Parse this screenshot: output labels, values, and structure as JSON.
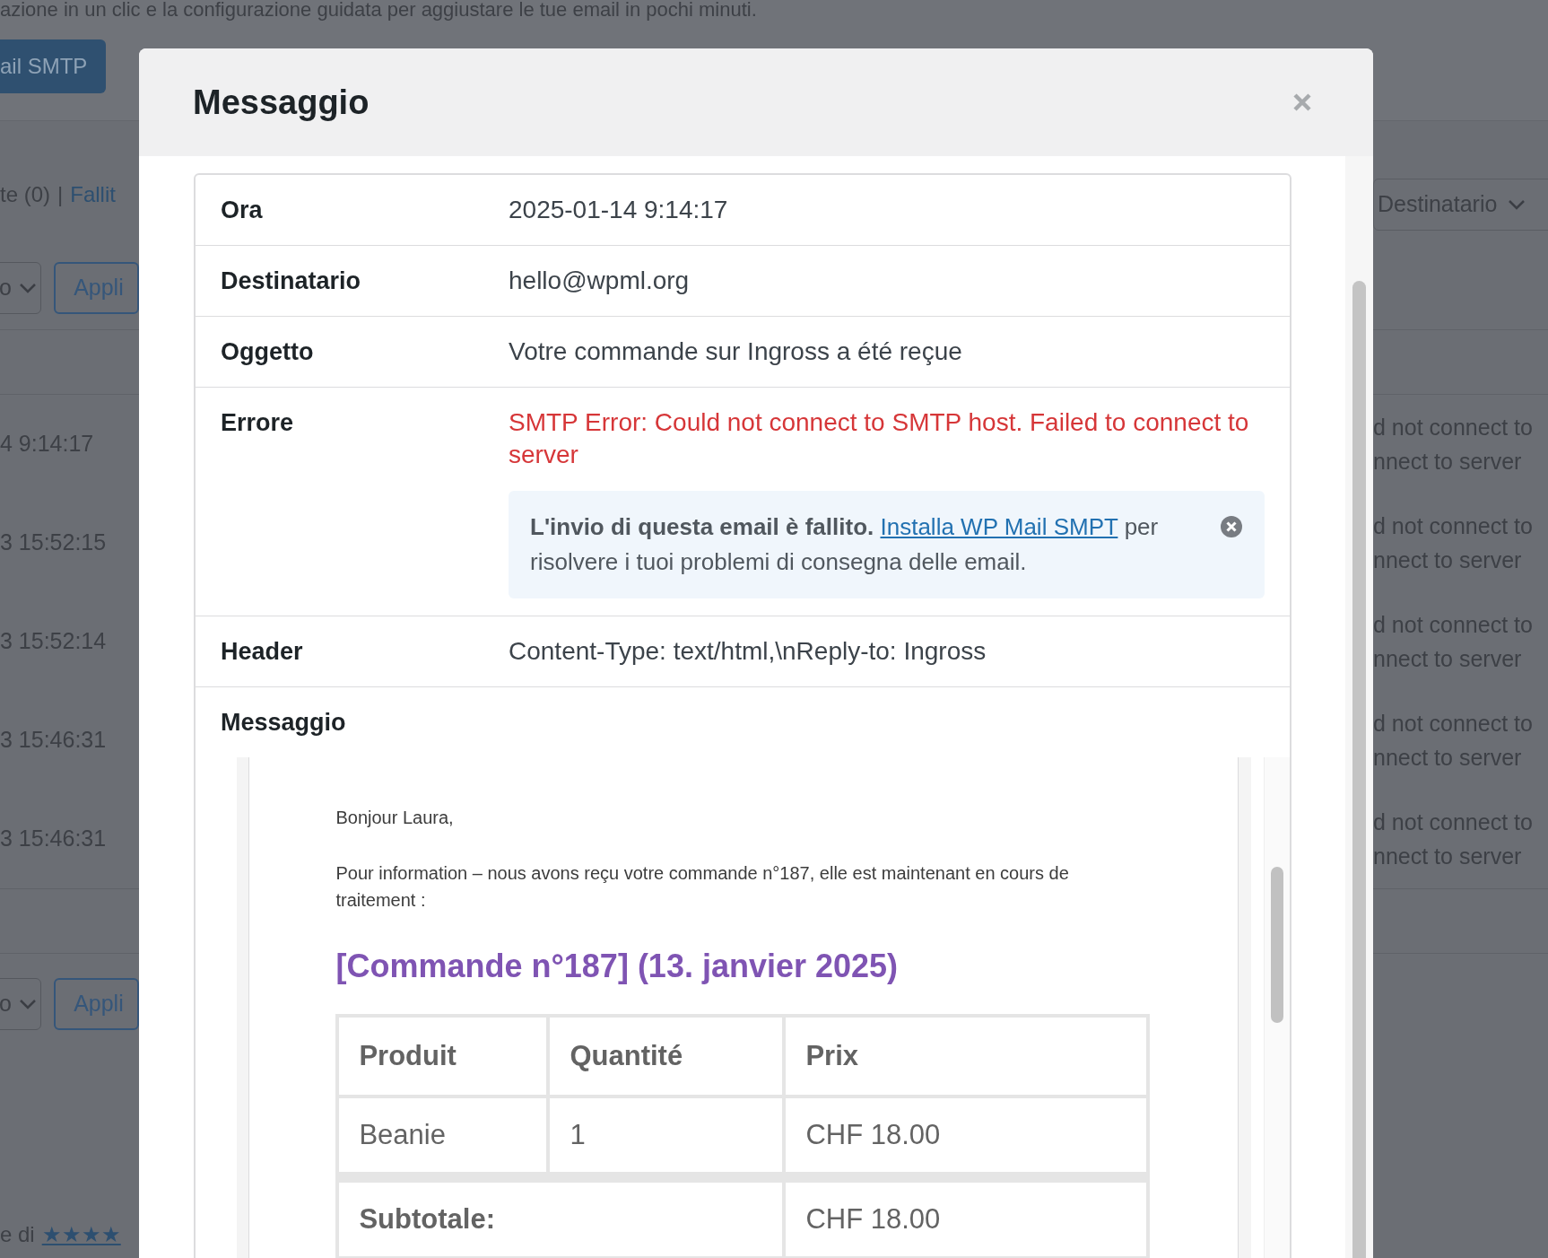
{
  "background": {
    "intro_text": "azione in un clic e la configurazione guidata per aggiustare le tue email in pochi minuti.",
    "smtp_button": "ail SMTP",
    "filter_count": "te (0)",
    "filter_separator": "|",
    "filter_link": "Fallit",
    "bulk_selects": [
      "o",
      "o"
    ],
    "apply_buttons": [
      "Appli",
      "Appli"
    ],
    "recipient_filter": "Destinatario",
    "rows": [
      {
        "time": "4 9:14:17",
        "error_line1": "d not connect to",
        "error_line2": "nnect to server"
      },
      {
        "time": "3 15:52:15",
        "error_line1": "d not connect to",
        "error_line2": "nnect to server"
      },
      {
        "time": "3 15:52:14",
        "error_line1": "d not connect to",
        "error_line2": "nnect to server"
      },
      {
        "time": "3 15:46:31",
        "error_line1": "d not connect to",
        "error_line2": "nnect to server"
      },
      {
        "time": "3 15:46:31",
        "error_line1": "d not connect to",
        "error_line2": "nnect to server"
      }
    ],
    "footer_text": "e di",
    "footer_link": "★★★★"
  },
  "modal": {
    "title": "Messaggio",
    "fields": [
      {
        "kind": "text",
        "label": "Ora",
        "value": "2025-01-14 9:14:17"
      },
      {
        "kind": "text",
        "label": "Destinatario",
        "value": "hello@wpml.org"
      },
      {
        "kind": "text",
        "label": "Oggetto",
        "value": "Votre commande sur Ingross a été reçue"
      },
      {
        "kind": "error",
        "label": "Errore",
        "value": "SMTP Error: Could not connect to SMTP host. Failed to connect to server",
        "notice": {
          "lead": "**L'invio di questa email è fallito.**",
          "link": "Installa WP Mail SMPT",
          "rest": "per risolvere i tuoi problemi di consegna delle email."
        }
      },
      {
        "kind": "text",
        "label": "Header",
        "value": "Content-Type: text/html,\\nReply-to: Ingross"
      },
      {
        "kind": "message",
        "label": "Messaggio"
      }
    ],
    "email": {
      "greeting": "Bonjour Laura,",
      "intro": "Pour information – nous avons reçu votre commande n°187, elle est maintenant en cours de traitement :",
      "heading": "[Commande n°187] (13. janvier 2025)",
      "columns": [
        "Produit",
        "Quantité",
        "Prix"
      ],
      "rows": [
        {
          "cells": [
            "Beanie",
            "1",
            "CHF 18.00"
          ]
        }
      ],
      "totals": [
        {
          "label": "Subtotale:",
          "value": "CHF 18.00"
        }
      ]
    }
  }
}
